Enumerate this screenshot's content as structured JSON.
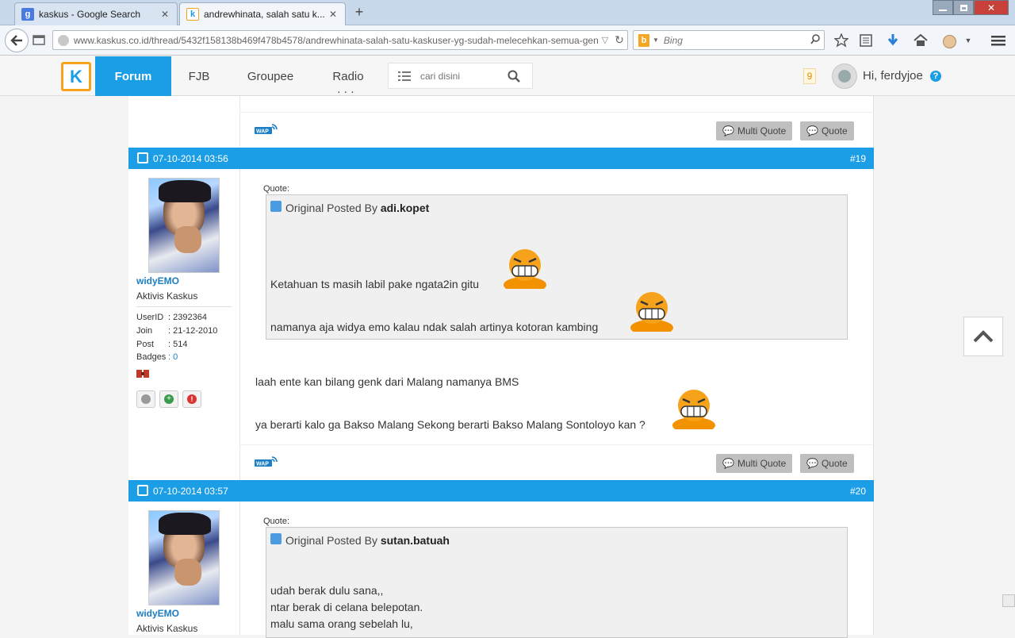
{
  "browser": {
    "tabs": [
      {
        "title": "kaskus - Google Search",
        "favicon": "g"
      },
      {
        "title": "andrewhinata, salah satu k...",
        "favicon": "k"
      }
    ],
    "url": "www.kaskus.co.id/thread/5432f158138b469f478b4578/andrewhinata-salah-satu-kaskuser-yg-sudah-melecehkan-semua-genk",
    "search_placeholder": "Bing"
  },
  "site": {
    "menu": [
      "Forum",
      "FJB",
      "Groupee",
      "Radio"
    ],
    "search_placeholder": "cari disini",
    "notification_count": "9",
    "greeting": "Hi, ferdyjoe",
    "brand_color": "#1c9ee6"
  },
  "actions": {
    "multi_quote": "Multi Quote",
    "quote": "Quote"
  },
  "posts": [
    {
      "date": "07-10-2014 03:56",
      "number": "#19",
      "user": {
        "name": "widyEMO",
        "rank": "Aktivis Kaskus",
        "stats": [
          {
            "k": "UserID",
            "v": ": 2392364"
          },
          {
            "k": "Join",
            "v": ": 21-12-2010"
          },
          {
            "k": "Post",
            "v": ": 514"
          },
          {
            "k": "Badges",
            "v": ": 0"
          }
        ]
      },
      "quote_label": "Quote:",
      "quote_prefix": "Original Posted By",
      "quote_author": "adi.kopet",
      "quote_lines": [
        "Ketahuan ts masih labil pake ngata2in gitu",
        "namanya aja widya emo kalau ndak salah artinya kotoran kambing"
      ],
      "body_lines": [
        "laah ente kan bilang genk dari Malang namanya BMS",
        "ya berarti kalo ga Bakso Malang Sekong berarti Bakso Malang Sontoloyo kan ?"
      ]
    },
    {
      "date": "07-10-2014 03:57",
      "number": "#20",
      "user": {
        "name": "widyEMO",
        "rank": "Aktivis Kaskus"
      },
      "quote_label": "Quote:",
      "quote_prefix": "Original Posted By",
      "quote_author": "sutan.batuah",
      "quote_lines": [
        "udah berak dulu sana,,",
        "ntar berak di celana belepotan.",
        "malu sama orang sebelah lu,"
      ]
    }
  ]
}
